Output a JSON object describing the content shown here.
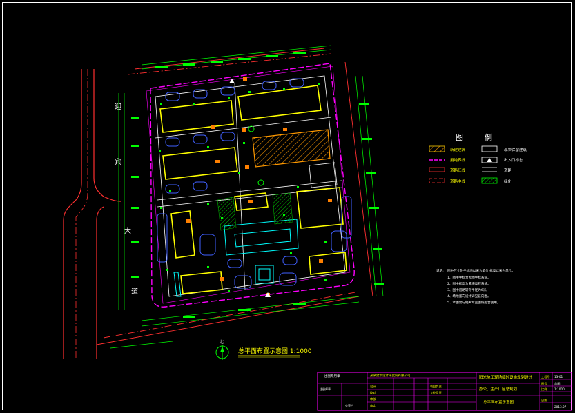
{
  "drawing": {
    "road_labels": [
      "迎",
      "宾",
      "大",
      "道"
    ],
    "plan_title": "总平面布置示意图 1:1000",
    "north_label": "北",
    "legend": {
      "title_left": "图",
      "title_right": "例",
      "items": [
        {
          "label": "新建建筑",
          "style": "hatch-yellow"
        },
        {
          "label": "用地界线",
          "style": "dash-magenta"
        },
        {
          "label": "道路红线",
          "style": "line-red"
        },
        {
          "label": "道路中线",
          "style": "dashdot-red"
        },
        {
          "label": "现状保留建筑",
          "style": "box-white"
        },
        {
          "label": "出入口标志",
          "style": "triangle-white"
        },
        {
          "label": "道路",
          "style": "line-white"
        },
        {
          "label": "绿化",
          "style": "hatch-green"
        }
      ]
    },
    "notes": {
      "heading": "说明:",
      "lines": [
        "图中尺寸及坐标均以米为单位,标高以米为单位。",
        "1、图中坐标为大地坐标系统。",
        "2、图中标高为黄海高程系统。",
        "3、图中道路转弯半径为6米。",
        "4、场地竖向设计详见竖向图。",
        "5、本图需与相关专业图纸配合使用。"
      ]
    },
    "colors": {
      "background": "#000000",
      "building": "#ffff00",
      "green": "#00ff00",
      "magenta": "#ff00ff",
      "cyan": "#00ffff",
      "red": "#ff0000",
      "blue": "#4040ff",
      "orange": "#ff8000",
      "white": "#ffffff"
    }
  },
  "title_block": {
    "project_title": "阳光施工现场临时设施规划设计",
    "drawing_name": "总平面布置示意图",
    "sub_title": "办公、生产厂区总规划",
    "cells": [
      "设计",
      "校对",
      "审核",
      "审定",
      "项目负责",
      "专业负责",
      "工程号",
      "图号",
      "比例",
      "日期"
    ],
    "values": [
      "13-01",
      "总图",
      "1:1000",
      "2013.07"
    ],
    "company": "某某建筑设计研究院有限公司",
    "stamp_labels": [
      "出图专用章",
      "注册师章",
      "会签栏"
    ]
  }
}
